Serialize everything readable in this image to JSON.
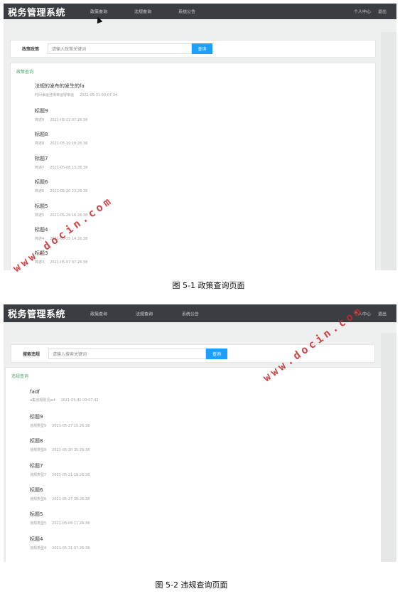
{
  "screens": [
    {
      "app_title": "税务管理系统",
      "nav_items": [
        "政策查询",
        "法规查询",
        "系统公告"
      ],
      "user_center": "个人中心",
      "logout": "退出",
      "search": {
        "label": "政策政策",
        "placeholder": "请输入政策关键词",
        "button": "查询"
      },
      "section_title": "政策查询",
      "items": [
        {
          "title": "法规的发布的发生的fa",
          "meta": "时间幸运挂得幸运得幸运",
          "time": "2021-05-31 00:07:34"
        },
        {
          "title": "标题9",
          "meta": "简述9",
          "time": "2021-05-22 07:26:38"
        },
        {
          "title": "标题8",
          "meta": "简述8",
          "time": "2021-05-19 18:26:38"
        },
        {
          "title": "标题7",
          "meta": "简述7",
          "time": "2021-05-08 13:26:38"
        },
        {
          "title": "标题6",
          "meta": "简述6",
          "time": "2021-05-20 23:26:38"
        },
        {
          "title": "标题5",
          "meta": "简述5",
          "time": "2021-05-29 16:26:38"
        },
        {
          "title": "标题4",
          "meta": "简述4",
          "time": "2021-05-25 14:26:38"
        },
        {
          "title": "标题3",
          "meta": "简述3",
          "time": "2021-05-07 07:26:38"
        }
      ]
    },
    {
      "app_title": "税务管理系统",
      "nav_items": [
        "政策查询",
        "法规查询",
        "系统公告"
      ],
      "user_center": "个人中心",
      "logout": "退出",
      "search": {
        "label": "搜索违规",
        "placeholder": "请输入搜索关键词",
        "button": "查询"
      },
      "section_title": "违规查询",
      "items": [
        {
          "title": "fadf",
          "meta": "a集违规刚况asf",
          "time": "2021-05-31 00:07:42"
        },
        {
          "title": "标题9",
          "meta": "违规类型9",
          "time": "2021-05-27 15:26:38"
        },
        {
          "title": "标题8",
          "meta": "违规类型8",
          "time": "2021-05-20 35:26:38"
        },
        {
          "title": "标题7",
          "meta": "违规类型7",
          "time": "2021-05-21 19:26:38"
        },
        {
          "title": "标题6",
          "meta": "违规类型6",
          "time": "2021-05-27 39:26:38"
        },
        {
          "title": "标题5",
          "meta": "违规类型5",
          "time": "2021-05-08 17:26:38"
        },
        {
          "title": "标题4",
          "meta": "违规类型4",
          "time": "2021-05-31 07:26:38"
        }
      ]
    }
  ],
  "captions": [
    "图 5-1 政策查询页面",
    "图 5-2 违规查询页面"
  ],
  "watermark": "www.docin.com",
  "colors": {
    "navbar": "#3a3d42",
    "button": "#1e9fff",
    "section_title": "#4aa36b",
    "watermark": "#c8282b"
  }
}
